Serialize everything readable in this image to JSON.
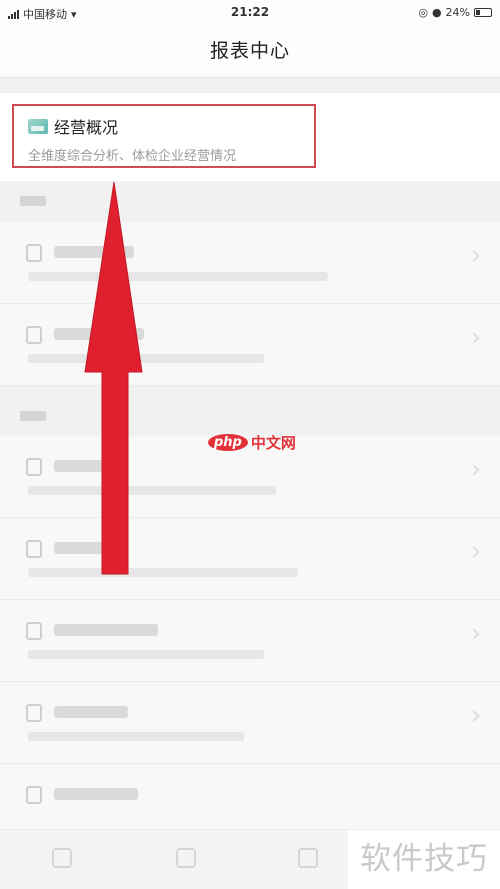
{
  "status_bar": {
    "carrier": "中国移动",
    "time": "21:22",
    "battery": "24%"
  },
  "header": {
    "title": "报表中心"
  },
  "overview": {
    "title": "经营概况",
    "subtitle": "全维度综合分析、体检企业经营情况"
  },
  "watermark": {
    "logo": "php",
    "center_text": "中文网",
    "corner_text": "软件技巧"
  },
  "colors": {
    "highlight_border": "#d24a57",
    "arrow": "#e0202e",
    "watermark_red": "#e3313a"
  }
}
